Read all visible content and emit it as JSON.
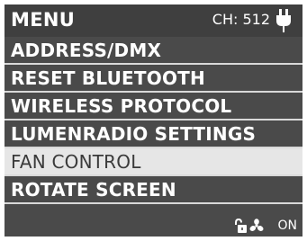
{
  "header": {
    "title": "MENU",
    "channel": "CH: 512",
    "power_icon": "plug-icon"
  },
  "menu": {
    "items": [
      {
        "label": "ADDRESS/DMX"
      },
      {
        "label": "RESET BLUETOOTH"
      },
      {
        "label": "WIRELESS PROTOCOL"
      },
      {
        "label": "LUMENRADIO SETTINGS"
      },
      {
        "label": "FAN CONTROL",
        "selected": true
      },
      {
        "label": "ROTATE SCREEN"
      }
    ]
  },
  "footer": {
    "lock_icon": "unlock-icon",
    "fan_icon": "fan-icon",
    "fan_status": "ON"
  },
  "colors": {
    "background": "#4a4a4a",
    "header": "#3f3f3f",
    "selected_row": "#e6e6e6",
    "divider": "#d9d9d9",
    "text": "#ffffff"
  }
}
